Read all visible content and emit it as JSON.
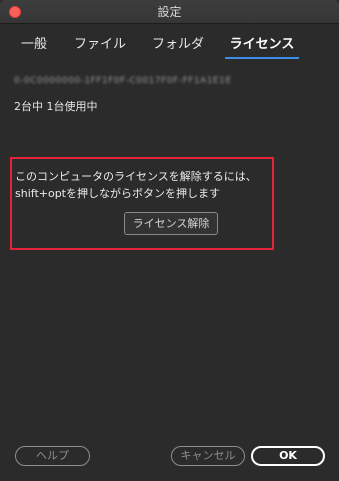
{
  "window": {
    "title": "設定"
  },
  "tabs": [
    {
      "label": "一般",
      "active": false
    },
    {
      "label": "ファイル",
      "active": false
    },
    {
      "label": "フォルダ",
      "active": false
    },
    {
      "label": "ライセンス",
      "active": true
    }
  ],
  "license": {
    "key": "0-0C0000000-1FF1F0F-C0017F0F-FF1A1E1E",
    "usage": "2台中 1台使用中"
  },
  "deactivate": {
    "line1": "このコンピュータのライセンスを解除するには、",
    "line2": "shift+optを押しながらボタンを押します",
    "button_label": "ライセンス解除"
  },
  "footer": {
    "help_label": "ヘルプ",
    "cancel_label": "キャンセル",
    "ok_label": "OK"
  },
  "colors": {
    "accent": "#3a8ee6",
    "highlight": "#e3243a",
    "close": "#fc5f57"
  }
}
